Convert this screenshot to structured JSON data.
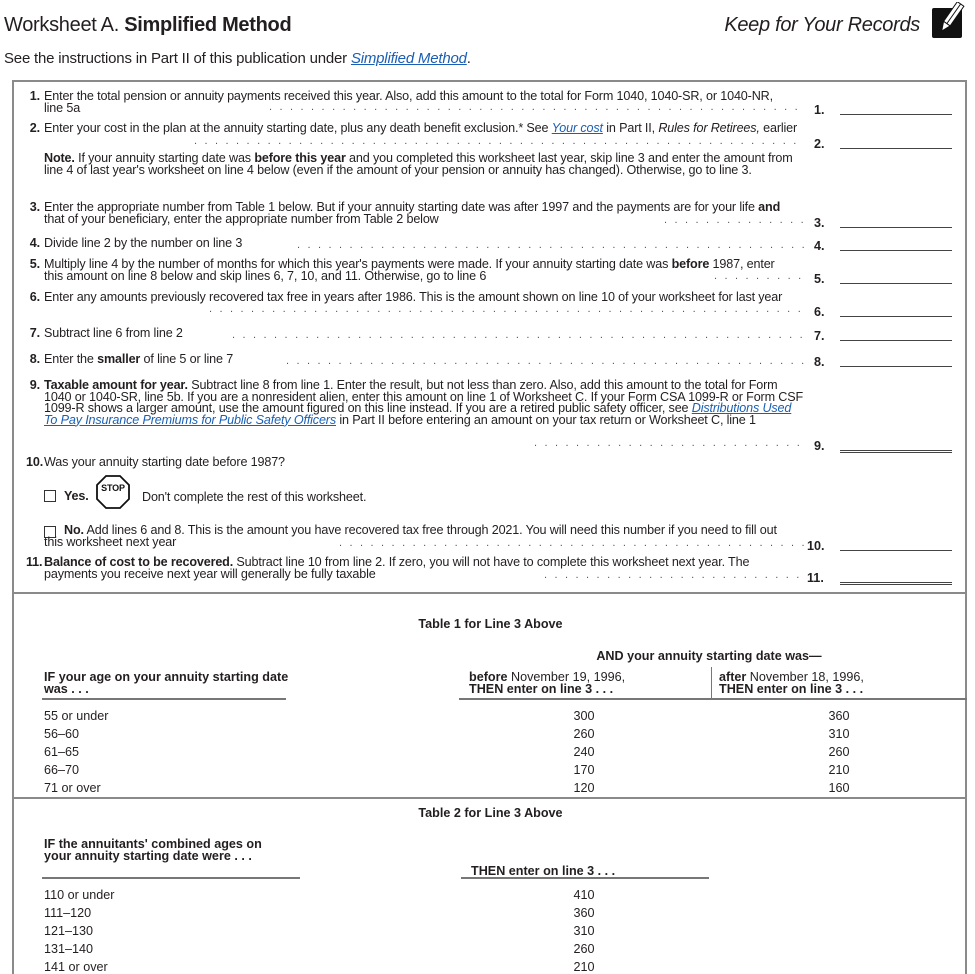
{
  "header": {
    "title_prefix": "Worksheet A.",
    "title_bold": "Simplified Method",
    "keep_label": "Keep for Your Records",
    "icon": "pencil-icon",
    "subtitle_before": "See the instructions in Part II of this publication under ",
    "subtitle_link": "Simplified Method",
    "subtitle_after": "."
  },
  "lines": [
    {
      "num": "1.",
      "text": "Enter the total pension or annuity payments received this year. Also, add this amount to the total for Form 1040, 1040-SR, or 1040-NR, line 5a",
      "answer_label": "1."
    },
    {
      "num": "2.",
      "text_before": "Enter your cost in the plan at the annuity starting date, plus any death benefit exclusion.* See ",
      "link": "Your cost",
      "text_mid": " in Part II, ",
      "italic": "Rules for Retirees,",
      "text_after": " earlier",
      "answer_label": "2."
    },
    {
      "note_bold": "Note.",
      "note_text1": " If your annuity starting date was ",
      "note_bold2": "before this year",
      "note_text2": " and you completed this worksheet last year, skip line 3 and enter the amount from line 4 of last year's worksheet on line 4 below (even if the amount of your pension or annuity has changed). Otherwise, go to line 3."
    },
    {
      "num": "3.",
      "text_before": "Enter the appropriate number from Table 1 below. But if your annuity starting date was after 1997 and the payments are for your life ",
      "bold": "and",
      "text_after": " that of your beneficiary, enter the appropriate number from Table 2 below",
      "answer_label": "3."
    },
    {
      "num": "4.",
      "text": "Divide line 2 by the number on line 3",
      "answer_label": "4."
    },
    {
      "num": "5.",
      "text_before": "Multiply line 4 by the number of months for which this year's payments were made. If your annuity starting date was ",
      "bold": "before",
      "text_after": " 1987, enter this amount on line 8 below and skip lines 6, 7, 10, and 11. Otherwise, go to line 6",
      "answer_label": "5."
    },
    {
      "num": "6.",
      "text": "Enter any amounts previously recovered tax free in years after 1986. This is the amount shown on line 10 of your worksheet for last year",
      "answer_label": "6."
    },
    {
      "num": "7.",
      "text": "Subtract line 6 from line 2",
      "answer_label": "7."
    },
    {
      "num": "8.",
      "text_before": "Enter the ",
      "bold": "smaller",
      "text_after": " of line 5 or line 7",
      "answer_label": "8."
    },
    {
      "num": "9.",
      "bold": "Taxable amount for year.",
      "text_before": " Subtract line 8 from line 1. Enter the result, but not less than zero. Also, add this amount to the total for Form 1040 or 1040-SR, line 5b. If you are a nonresident alien, enter this amount on line 1 of Worksheet C. If your Form CSA 1099-R or Form CSF 1099-R shows a larger amount, use the amount figured on this line instead. If you are a retired public safety officer, see ",
      "link": "Distributions Used To Pay Insurance Premiums for Public Safety Officers",
      "text_after": " in Part II before entering an amount on your tax return or Worksheet C, line 1",
      "answer_label": "9."
    },
    {
      "num": "10.",
      "text": "Was your annuity starting date before 1987?",
      "yes_label": "Yes.",
      "stop_text": "STOP",
      "yes_text": "Don't complete the rest of this worksheet.",
      "no_label": "No.",
      "no_text": " Add lines 6 and 8. This is the amount you have recovered tax free through 2021. You will need this number if you need to fill out this worksheet next year",
      "answer_label": "10."
    },
    {
      "num": "11.",
      "bold": "Balance of cost to be recovered.",
      "text": " Subtract line 10 from line 2. If zero, you will not have to complete this worksheet next year. The payments you receive next year will generally be fully taxable",
      "answer_label": "11."
    }
  ],
  "table1": {
    "caption": "Table 1 for Line 3 Above",
    "group_header": "AND your annuity starting date was—",
    "col1_header": "IF your age on your annuity starting date was . . .",
    "col2_bold": "before",
    "col2_text": " November 19, 1996,",
    "col2_line2": "THEN enter on line 3 . . .",
    "col3_bold": "after",
    "col3_text": " November 18, 1996,",
    "col3_line2": "THEN enter on line 3 . . .",
    "rows": [
      {
        "age": "55 or under",
        "before": "300",
        "after": "360"
      },
      {
        "age": "56–60",
        "before": "260",
        "after": "310"
      },
      {
        "age": "61–65",
        "before": "240",
        "after": "260"
      },
      {
        "age": "66–70",
        "before": "170",
        "after": "210"
      },
      {
        "age": "71 or over",
        "before": "120",
        "after": "160"
      }
    ]
  },
  "table2": {
    "caption": "Table 2 for Line 3 Above",
    "col1_header": "IF the annuitants' combined ages on your annuity starting date were . . .",
    "col2_header": "THEN enter on line 3 . . .",
    "rows": [
      {
        "ages": "110 or under",
        "value": "410"
      },
      {
        "ages": "111–120",
        "value": "360"
      },
      {
        "ages": "121–130",
        "value": "310"
      },
      {
        "ages": "131–140",
        "value": "260"
      },
      {
        "ages": "141 or over",
        "value": "210"
      }
    ]
  }
}
